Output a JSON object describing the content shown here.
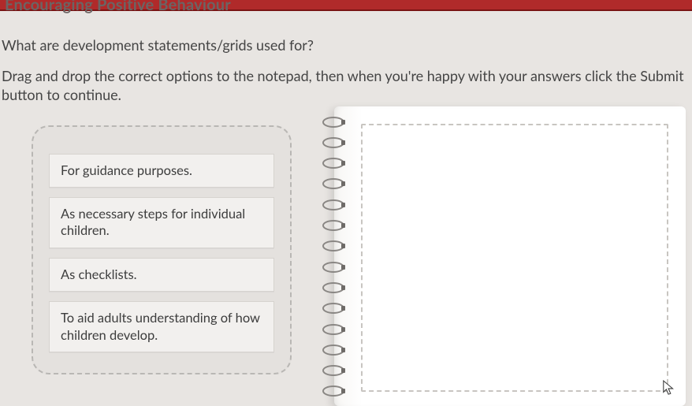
{
  "header": {
    "title_fragment": "Encouraging Positive Behaviour"
  },
  "question": "What are development statements/grids used for?",
  "instructions": "Drag and drop the correct options to the notepad, then when you're happy with your answers click the Submit button to continue.",
  "options": [
    "For guidance purposes.",
    "As necessary steps for individual children.",
    "As checklists.",
    "To aid adults understanding of how children develop."
  ]
}
